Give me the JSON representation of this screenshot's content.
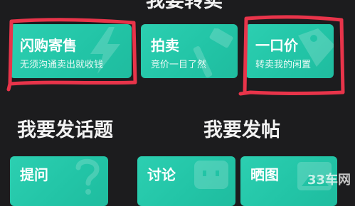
{
  "sections": {
    "sell_title": "我要转卖",
    "topic_title": "我要发话题",
    "post_title": "我要发帖"
  },
  "sell_cards": [
    {
      "name": "闪购寄售",
      "desc": "无须沟通卖出就收钱"
    },
    {
      "name": "拍卖",
      "desc": "竞价一目了然"
    },
    {
      "name": "一口价",
      "desc": "转卖我的闲置"
    }
  ],
  "topic_cards": [
    {
      "name": "提问",
      "desc": ""
    }
  ],
  "post_cards": [
    {
      "name": "讨论",
      "desc": ""
    },
    {
      "name": "晒图",
      "desc": ""
    }
  ],
  "watermark": "33车网",
  "colors": {
    "background": "#1c1c1e",
    "card": "#24c7a8",
    "highlight": "#e8344a"
  }
}
